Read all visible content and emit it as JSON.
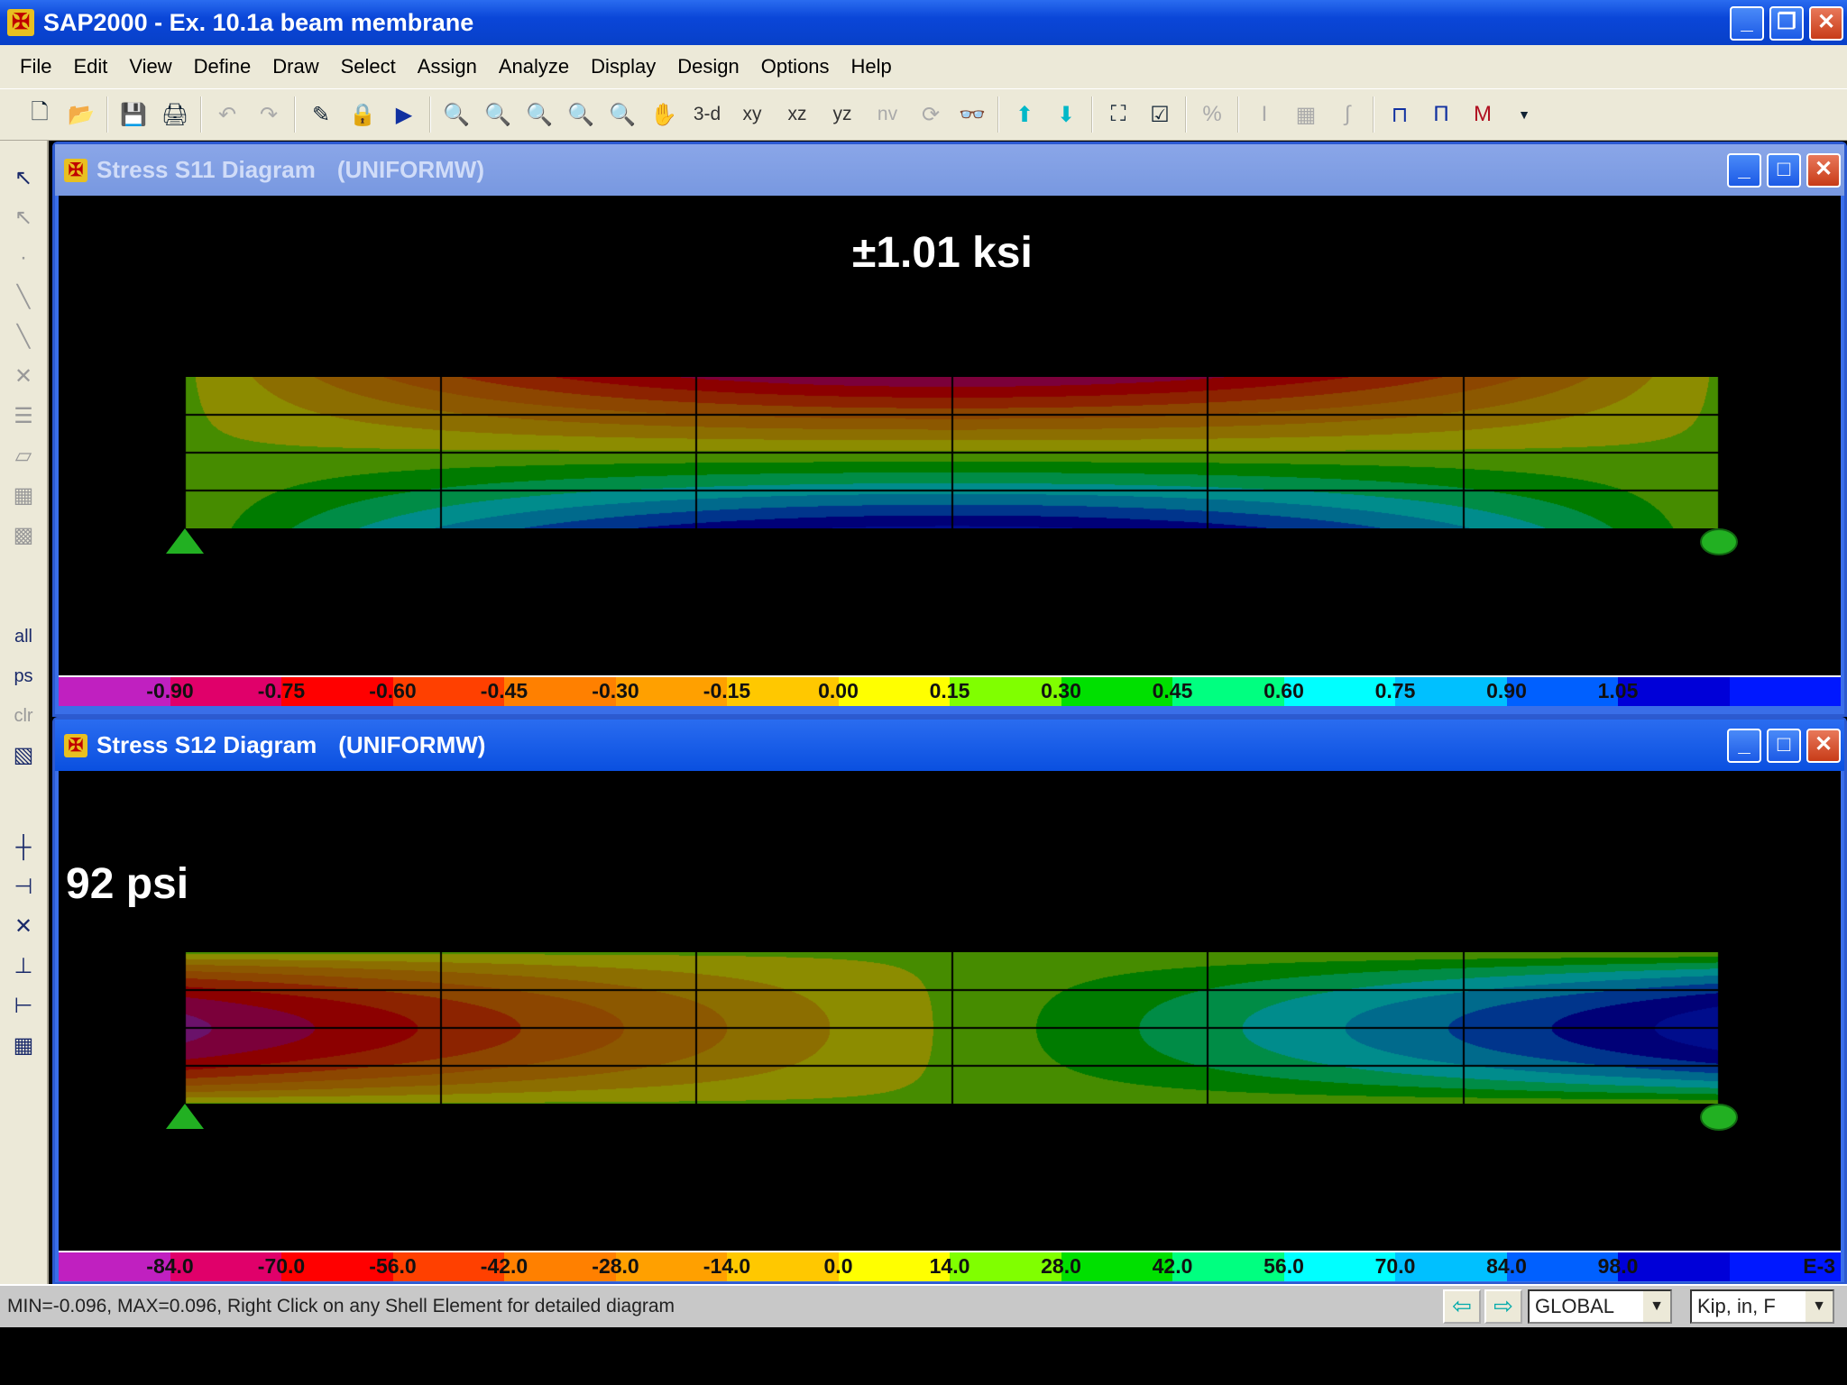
{
  "app": {
    "title": "SAP2000 - Ex. 10.1a beam membrane",
    "icon": "sap-logo-icon"
  },
  "menu": [
    "File",
    "Edit",
    "View",
    "Define",
    "Draw",
    "Select",
    "Assign",
    "Analyze",
    "Display",
    "Design",
    "Options",
    "Help"
  ],
  "toolbar": {
    "view_3d": "3-d",
    "view_xy": "xy",
    "view_xz": "xz",
    "view_yz": "yz",
    "view_nv": "nv"
  },
  "left_toolbar": {
    "all": "all",
    "ps": "ps",
    "clr": "clr"
  },
  "colorbar_colors": [
    "#c020c0",
    "#e0006a",
    "#ff0000",
    "#ff4000",
    "#ff8000",
    "#ffa000",
    "#ffc800",
    "#ffff00",
    "#80ff00",
    "#00e000",
    "#00ff80",
    "#00ffff",
    "#00c0ff",
    "#0060ff",
    "#0000d8",
    "#0018ff"
  ],
  "windows": [
    {
      "title": "Stress S11 Diagram",
      "case": "(UNIFORMW)",
      "annotation": "±1.01 ksi",
      "colorbar": [
        "-0.90",
        "-0.75",
        "-0.60",
        "-0.45",
        "-0.30",
        "-0.15",
        "0.00",
        "0.15",
        "0.30",
        "0.45",
        "0.60",
        "0.75",
        "0.90",
        "1.05"
      ],
      "range": [
        -1.01,
        1.01
      ]
    },
    {
      "title": "Stress S12 Diagram",
      "case": "(UNIFORMW)",
      "annotation": "92 psi",
      "colorbar": [
        "-84.0",
        "-70.0",
        "-56.0",
        "-42.0",
        "-28.0",
        "-14.0",
        "0.0",
        "14.0",
        "28.0",
        "42.0",
        "56.0",
        "70.0",
        "84.0",
        "98.0"
      ],
      "colorbar_exponent": "E-3",
      "range": [
        -0.092,
        0.092
      ]
    }
  ],
  "status": {
    "message": "MIN=-0.096, MAX=0.096, Right Click on any Shell Element for detailed diagram",
    "coord_system": "GLOBAL",
    "units": "Kip, in, F"
  }
}
